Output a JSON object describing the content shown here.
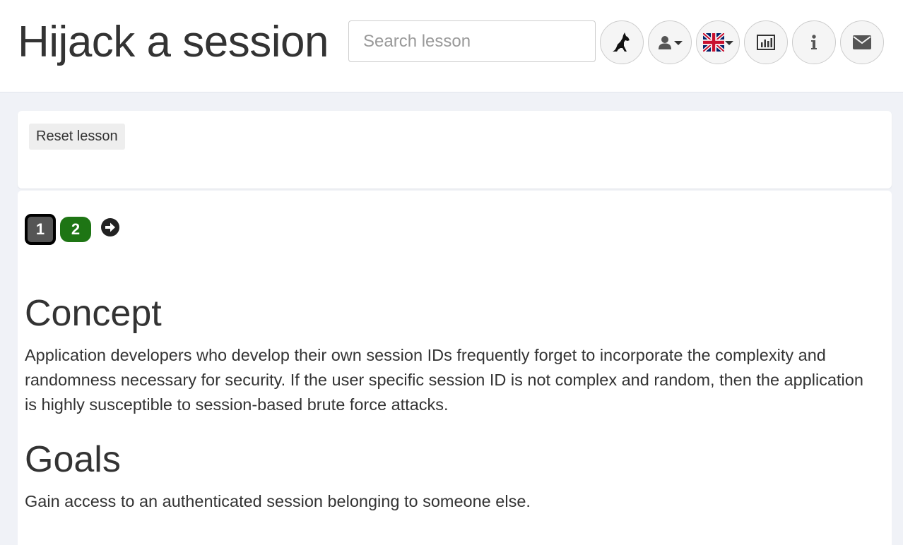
{
  "header": {
    "title": "Hijack a session",
    "search_placeholder": "Search lesson"
  },
  "toolbar": {
    "buttons": [
      {
        "name": "wolf-icon"
      },
      {
        "name": "user-icon",
        "dropdown": true
      },
      {
        "name": "uk-flag-icon",
        "dropdown": true
      },
      {
        "name": "bar-chart-icon"
      },
      {
        "name": "info-icon"
      },
      {
        "name": "envelope-icon"
      }
    ]
  },
  "lesson": {
    "reset_label": "Reset lesson",
    "pages": [
      {
        "label": "1",
        "state": "current",
        "color": "#555555"
      },
      {
        "label": "2",
        "state": "solved",
        "color": "#1e7514"
      }
    ],
    "next_icon": "arrow-right-circle-icon"
  },
  "content": {
    "concept_heading": "Concept",
    "concept_text": "Application developers who develop their own session IDs frequently forget to incorporate the complexity and randomness necessary for security. If the user specific session ID is not complex and random, then the application is highly susceptible to session-based brute force attacks.",
    "goals_heading": "Goals",
    "goals_text": "Gain access to an authenticated session belonging to someone else."
  }
}
